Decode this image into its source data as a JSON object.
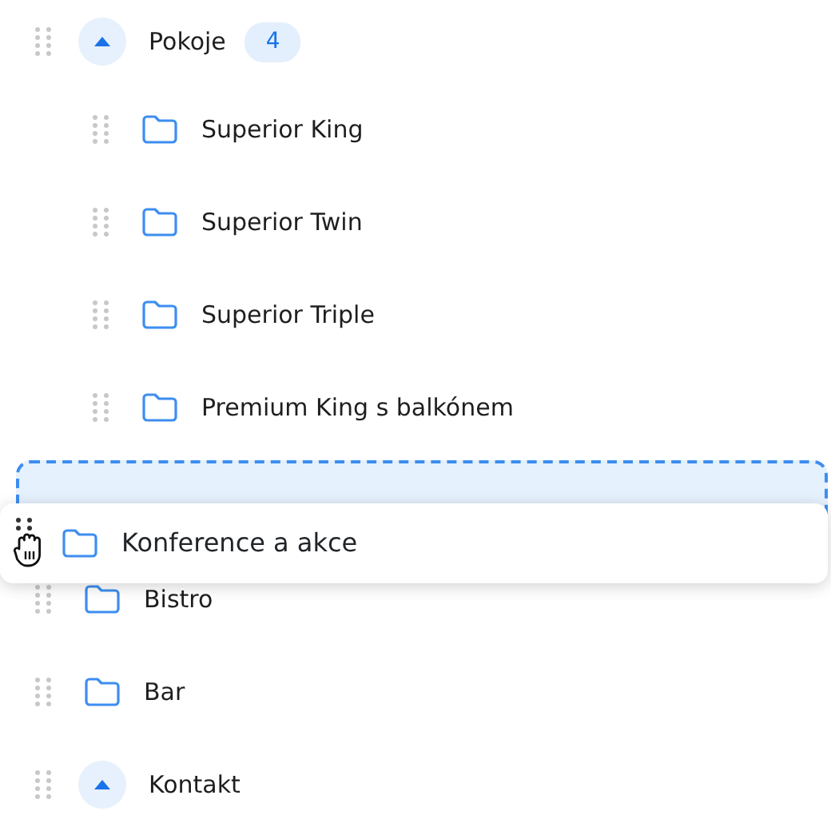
{
  "tree": [
    {
      "kind": "section",
      "label": "Pokoje",
      "expanded": true,
      "count": "4",
      "children": [
        {
          "kind": "folder",
          "label": "Superior King"
        },
        {
          "kind": "folder",
          "label": "Superior Twin"
        },
        {
          "kind": "folder",
          "label": "Superior Triple"
        },
        {
          "kind": "folder",
          "label": "Premium King s balkónem"
        }
      ]
    },
    {
      "kind": "drop-target"
    },
    {
      "kind": "folder",
      "label": "Bistro"
    },
    {
      "kind": "folder",
      "label": "Bar"
    },
    {
      "kind": "section",
      "label": "Kontakt",
      "expanded": true
    }
  ],
  "dragged_item": {
    "kind": "folder",
    "label": "Konference a akce"
  }
}
